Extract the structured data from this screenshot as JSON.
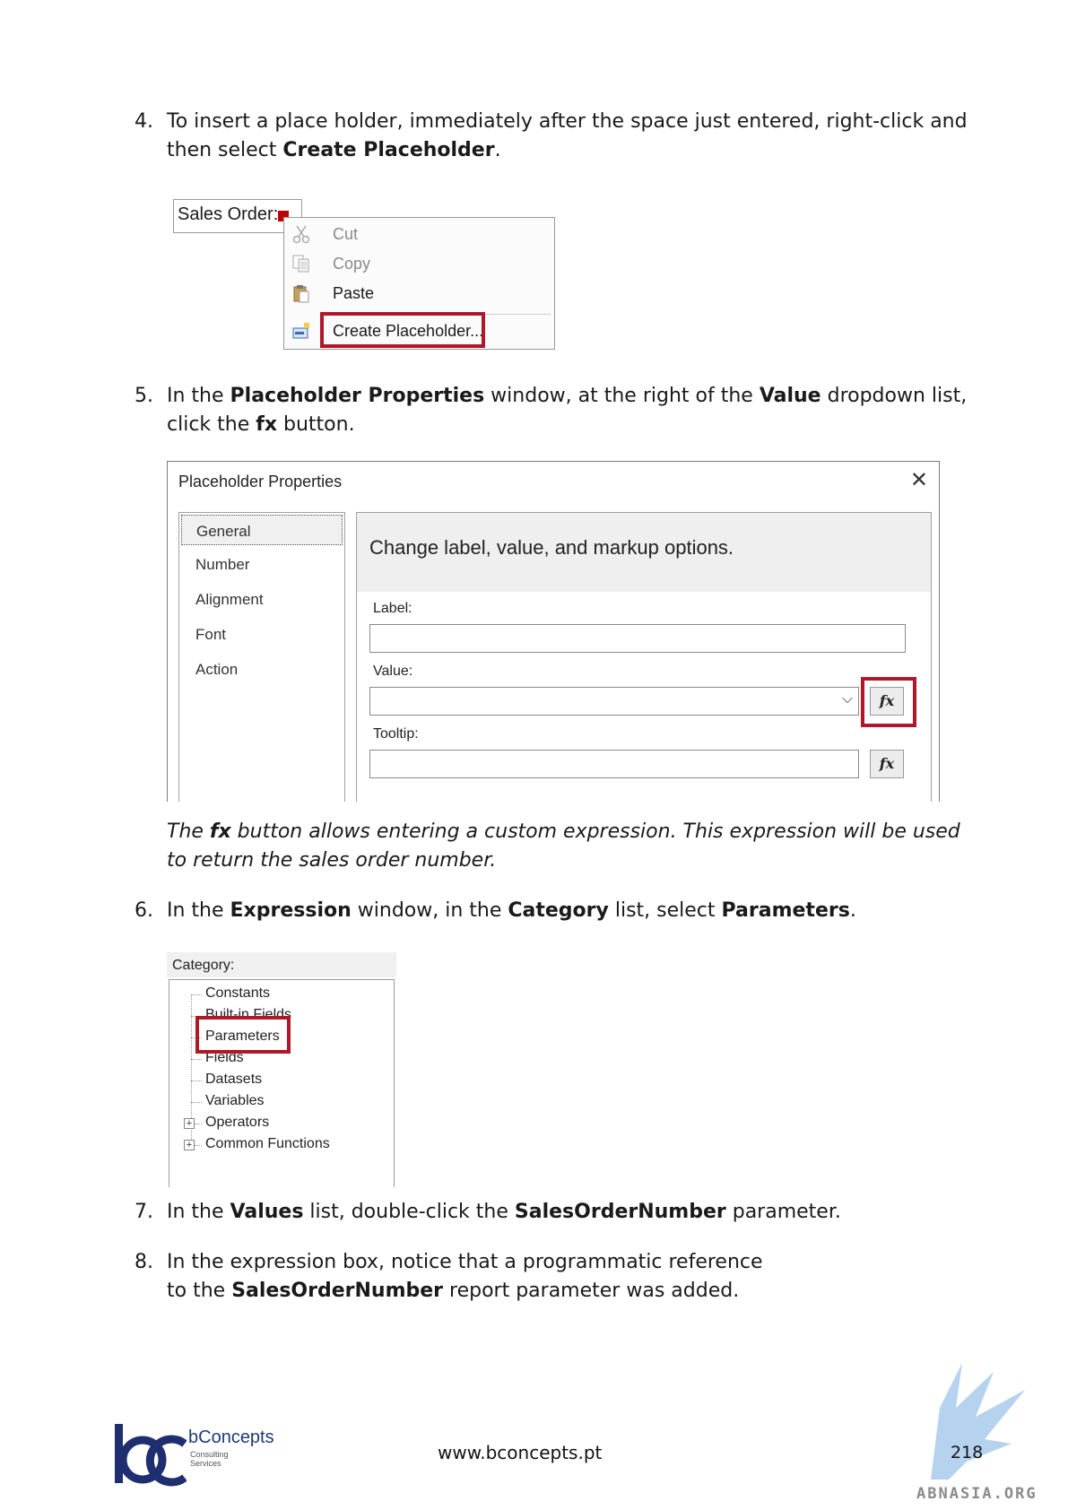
{
  "steps": [
    {
      "num": "4.",
      "pre": "To insert a place holder, immediately after the space just entered, right-click and then select ",
      "b1": "Create Placeholder",
      "post": "."
    },
    {
      "num": "5.",
      "t1": "In the ",
      "b1": "Placeholder Properties",
      "t2": " window, at the right of the ",
      "b2": "Value",
      "t3": " dropdown list, click the ",
      "b3": "fx",
      "t4": " button."
    },
    {
      "num": "6.",
      "t1": "In the ",
      "b1": "Expression",
      "t2": " window, in the ",
      "b2": "Category",
      "t3": " list, select ",
      "b3": "Parameters",
      "t4": "."
    },
    {
      "num": "7.",
      "t1": "In the ",
      "b1": "Values",
      "t2": " list, double-click the ",
      "b2": "SalesOrderNumber",
      "t3": " parameter."
    },
    {
      "num": "8.",
      "t1": "In the expression box, notice that a programmatic reference to the ",
      "b1": "SalesOrderNumber",
      "t2": " report parameter was added."
    }
  ],
  "note": {
    "t1": "The ",
    "b1": "fx",
    "t2": " button allows entering a custom expression. This expression will be used to return the sales order number",
    "t3": "."
  },
  "context_menu": {
    "field_text": "Sales Order:",
    "items": [
      {
        "label": "Cut",
        "icon": "scissors-icon",
        "enabled": false
      },
      {
        "label": "Copy",
        "icon": "copy-icon",
        "enabled": false
      },
      {
        "label": "Paste",
        "icon": "paste-icon",
        "enabled": true
      },
      {
        "label": "Create Placeholder...",
        "icon": "placeholder-icon",
        "enabled": true
      }
    ]
  },
  "dialog": {
    "title": "Placeholder Properties",
    "close": "✕",
    "nav": [
      "General",
      "Number",
      "Alignment",
      "Font",
      "Action"
    ],
    "selected_nav": "General",
    "header": "Change label, value, and markup options.",
    "label_caption": "Label:",
    "value_caption": "Value:",
    "tooltip_caption": "Tooltip:",
    "label_value": "",
    "value_value": "",
    "tooltip_value": "",
    "fx_label": "fx",
    "dropdown_glyph": "⌵"
  },
  "category": {
    "caption": "Category:",
    "items": [
      "Constants",
      "Built-in Fields",
      "Parameters",
      "Fields",
      "Datasets",
      "Variables",
      "Operators",
      "Common Functions"
    ],
    "selected": "Parameters",
    "expandable": [
      "Operators",
      "Common Functions"
    ]
  },
  "footer": {
    "brand": "bConcepts",
    "brand_sub1": "Consulting",
    "brand_sub2": "Services",
    "url": "www.bconcepts.pt",
    "page": "218",
    "watermark": "ABNASIA.ORG"
  },
  "colors": {
    "highlight": "#b0182a",
    "brand_blue": "#1f3b7a",
    "marker_red": "#c00000"
  }
}
